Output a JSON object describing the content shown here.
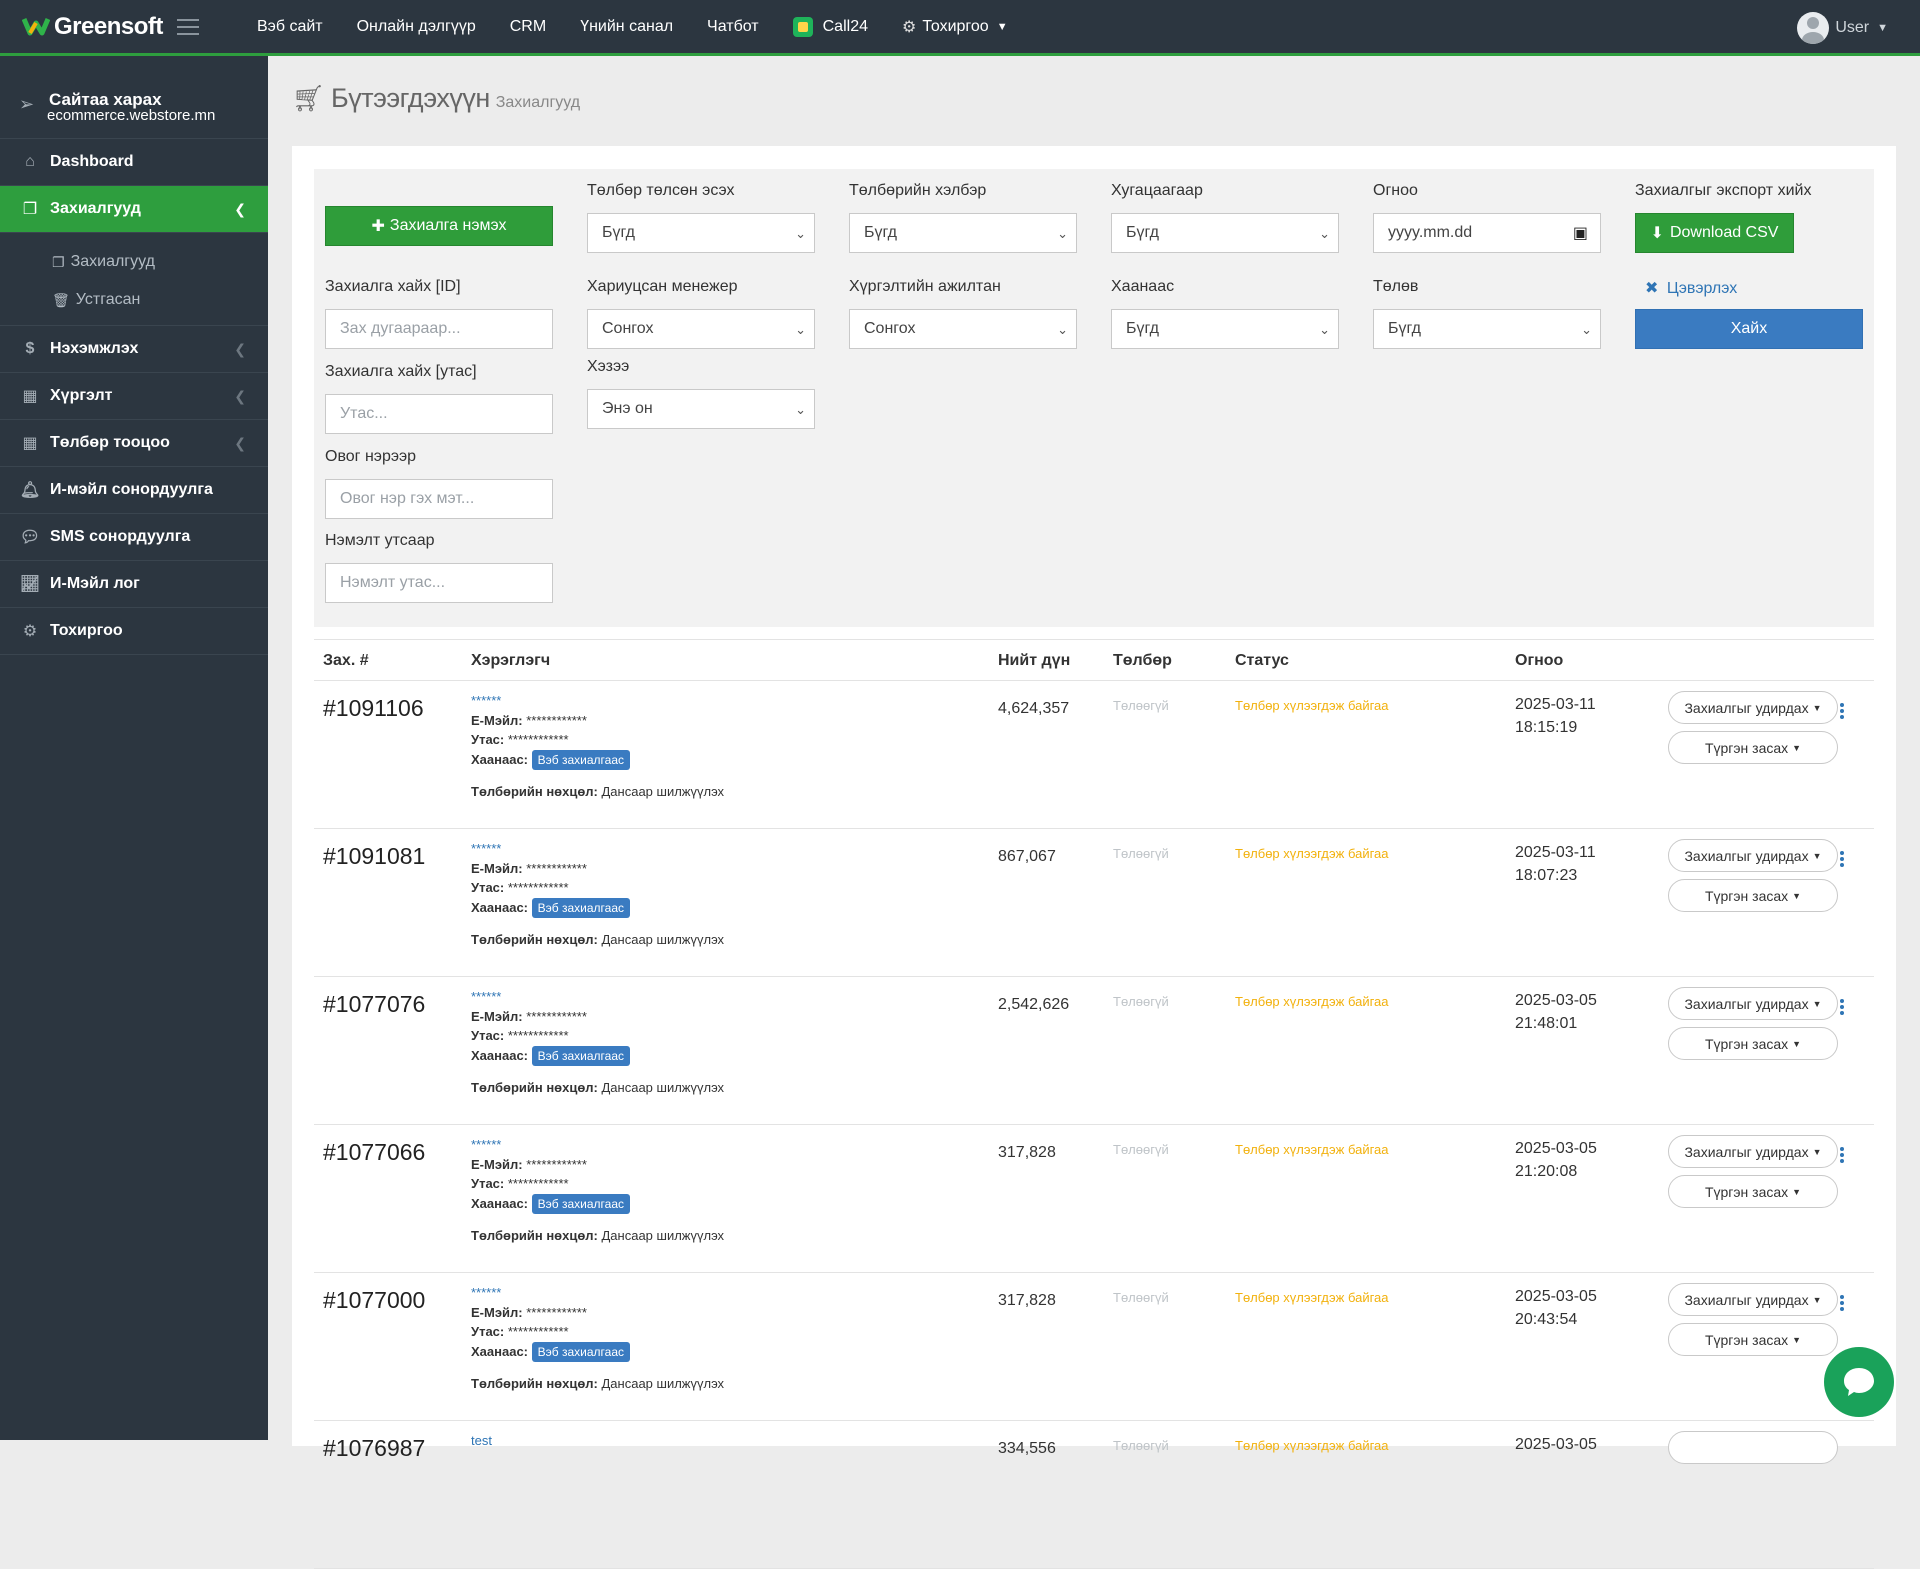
{
  "brand": {
    "name": "Greensoft"
  },
  "topnav": {
    "items": [
      "Вэб сайт",
      "Онлайн дэлгүүр",
      "CRM",
      "Үнийн санал",
      "Чатбот"
    ],
    "call": "Call24",
    "settings": "Тохиргоо"
  },
  "user": {
    "name": "User"
  },
  "sidebar": {
    "site_title": "Сайтаа харах",
    "site_url": "ecommerce.webstore.mn",
    "items": [
      {
        "label": "Dashboard",
        "icon": "home-icon"
      },
      {
        "label": "Захиалгууд",
        "icon": "clipboard-icon",
        "active": true
      },
      {
        "label": "Нэхэмжлэх",
        "icon": "dollar-icon"
      },
      {
        "label": "Хүргэлт",
        "icon": "grid-icon"
      },
      {
        "label": "Төлбөр тооцоо",
        "icon": "grid-icon"
      },
      {
        "label": "И-мэйл сонордуулга",
        "icon": "bell-icon"
      },
      {
        "label": "SMS сонордуулга",
        "icon": "chat-icon"
      },
      {
        "label": "И-Мэйл лог",
        "icon": "chart-icon"
      },
      {
        "label": "Тохиргоо",
        "icon": "gear-icon"
      }
    ],
    "sub_items": [
      "Захиалгууд",
      "Устгасан"
    ]
  },
  "page": {
    "title": "Бүтээгдэхүүн",
    "subtitle": "Захиалгууд"
  },
  "filters": {
    "add_order": "Захиалга нэмэх",
    "paid_label": "Төлбөр төлсөн эсэх",
    "paid_value": "Бүгд",
    "paytype_label": "Төлбөрийн хэлбэр",
    "paytype_value": "Бүгд",
    "deadline_label": "Хугацаагаар",
    "deadline_value": "Бүгд",
    "date_label": "Огноо",
    "date_placeholder": "yyyy.mm.dd",
    "export_label": "Захиалгыг экспорт хийх",
    "export_button": "Download CSV",
    "search_id_label": "Захиалга хайх [ID]",
    "search_id_placeholder": "Зах дугаараар...",
    "manager_label": "Хариуцсан менежер",
    "manager_value": "Сонгох",
    "courier_label": "Хүргэлтийн ажилтан",
    "courier_value": "Сонгох",
    "source_label": "Хаанаас",
    "source_value": "Бүгд",
    "status_label": "Төлөв",
    "status_value": "Бүгд",
    "clear": "Цэвэрлэх",
    "search_button": "Хайх",
    "search_phone_label": "Захиалга хайх [утас]",
    "search_phone_placeholder": "Утас...",
    "when_label": "Хэзээ",
    "when_value": "Энэ он",
    "name_label": "Овог нэрээр",
    "name_placeholder": "Овог нэр гэх мэт...",
    "extra_phone_label": "Нэмэлт утсаар",
    "extra_phone_placeholder": "Нэмэлт утас..."
  },
  "table": {
    "headers": {
      "id": "Зах. #",
      "customer": "Хэрэглэгч",
      "total": "Нийт дүн",
      "payment": "Төлбөр",
      "status": "Статус",
      "date": "Огноо"
    },
    "labels": {
      "email": "Е-Мэйл:",
      "phone": "Утас:",
      "source": "Хаанаас:",
      "pay_cond": "Төлбөрийн нөхцөл:",
      "manage": "Захиалгыг удирдах",
      "quick_edit": "Түргэн засах"
    },
    "rows": [
      {
        "id": "#1091106",
        "name": "******",
        "email": "************",
        "phone": "************",
        "source": "Вэб захиалгаас",
        "pay_cond": "Дансаар шилжүүлэх",
        "total": "4,624,357",
        "paid": "Төлөөгүй",
        "status": "Төлбөр хүлээгдэж байгаа",
        "date": "2025-03-11",
        "time": "18:15:19"
      },
      {
        "id": "#1091081",
        "name": "******",
        "email": "************",
        "phone": "************",
        "source": "Вэб захиалгаас",
        "pay_cond": "Дансаар шилжүүлэх",
        "total": "867,067",
        "paid": "Төлөөгүй",
        "status": "Төлбөр хүлээгдэж байгаа",
        "date": "2025-03-11",
        "time": "18:07:23"
      },
      {
        "id": "#1077076",
        "name": "******",
        "email": "************",
        "phone": "************",
        "source": "Вэб захиалгаас",
        "pay_cond": "Дансаар шилжүүлэх",
        "total": "2,542,626",
        "paid": "Төлөөгүй",
        "status": "Төлбөр хүлээгдэж байгаа",
        "date": "2025-03-05",
        "time": "21:48:01"
      },
      {
        "id": "#1077066",
        "name": "******",
        "email": "************",
        "phone": "************",
        "source": "Вэб захиалгаас",
        "pay_cond": "Дансаар шилжүүлэх",
        "total": "317,828",
        "paid": "Төлөөгүй",
        "status": "Төлбөр хүлээгдэж байгаа",
        "date": "2025-03-05",
        "time": "21:20:08"
      },
      {
        "id": "#1077000",
        "name": "******",
        "email": "************",
        "phone": "************",
        "source": "Вэб захиалгаас",
        "pay_cond": "Дансаар шилжүүлэх",
        "total": "317,828",
        "paid": "Төлөөгүй",
        "status": "Төлбөр хүлээгдэж байгаа",
        "date": "2025-03-05",
        "time": "20:43:54"
      },
      {
        "id": "#1076987",
        "name": "test",
        "email": "",
        "phone": "",
        "source": "",
        "pay_cond": "",
        "total": "334,556",
        "paid": "Төлөөгүй",
        "status": "Төлбөр хүлээгдэж байгаа",
        "date": "2025-03-05",
        "time": ""
      }
    ]
  },
  "colors": {
    "sidebar": "#2c3640",
    "accent_green": "#2f9d3a",
    "link_blue": "#2f75b5",
    "status_amber": "#f2b10d"
  }
}
